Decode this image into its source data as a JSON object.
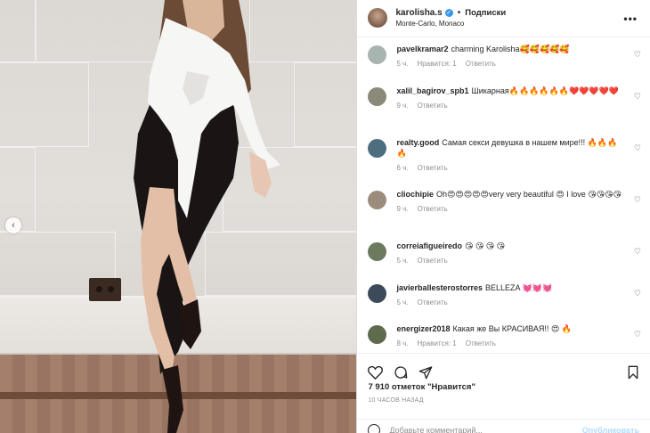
{
  "header": {
    "username": "karolisha.s",
    "follow_label": "Подписки",
    "location": "Monte-Carlo, Monaco",
    "more_glyph": "•••"
  },
  "comments": [
    {
      "user": "pavelkramar2",
      "text": "charming Karolisha🥰🥰🥰🥰🥰",
      "time": "5 ч.",
      "likes": "Нравится: 1",
      "reply": "Ответить",
      "avatar_color": "#a7b4b0"
    },
    {
      "user": "xalil_bagirov_spb1",
      "text": "Шикарная🔥🔥🔥🔥🔥🔥❤️❤️❤️❤️❤️",
      "time": "9 ч.",
      "likes": "",
      "reply": "Ответить",
      "avatar_color": "#8a8a7a"
    },
    {
      "user": "realty.good",
      "text": "Самая секси девушка в нашем мире!!! 🔥🔥🔥🔥",
      "time": "6 ч.",
      "likes": "",
      "reply": "Ответить",
      "avatar_color": "#4d6e7f"
    },
    {
      "user": "cliochipie",
      "text": "Oh😍😍😍😍😍very very beautiful 😍 I love 😘😘😘😘",
      "time": "9 ч.",
      "likes": "",
      "reply": "Ответить",
      "avatar_color": "#9c8c7e"
    },
    {
      "user": "correiafigueiredo",
      "text": "😘 😘 😘 😘",
      "time": "5 ч.",
      "likes": "",
      "reply": "Ответить",
      "avatar_color": "#6c7a5e"
    },
    {
      "user": "javierballesterostorres",
      "text": "BELLEZA 💓💓💓",
      "time": "5 ч.",
      "likes": "",
      "reply": "Ответить",
      "avatar_color": "#3d4a5a"
    },
    {
      "user": "energizer2018",
      "text": "Какая же Вы КРАСИВАЯ!! 😍 🔥",
      "time": "8 ч.",
      "likes": "Нравится: 1",
      "reply": "Ответить",
      "avatar_color": "#5e6b4d"
    }
  ],
  "actions": {
    "likes_text": "7 910 отметок \"Нравится\"",
    "time_ago": "10 ЧАСОВ НАЗАД",
    "comment_placeholder": "Добавьте комментарий...",
    "publish_label": "Опубликовать"
  },
  "icons": [
    "heart-icon",
    "comment-icon",
    "share-icon",
    "bookmark-icon",
    "emoji-icon",
    "more-icon",
    "chevron-left-icon"
  ],
  "colors": {
    "link_blue": "#3897f0",
    "publish_disabled": "#b3dbff",
    "muted": "#8e8e8e"
  }
}
